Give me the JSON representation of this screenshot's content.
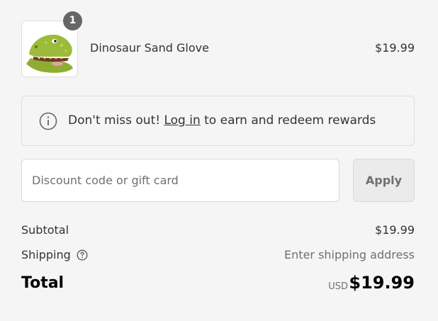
{
  "line_item": {
    "quantity": "1",
    "name": "Dinosaur Sand Glove",
    "price": "$19.99",
    "image": "dinosaur-sand-glove-thumbnail"
  },
  "rewards": {
    "text_before": "Don't miss out! ",
    "link_label": "Log in",
    "text_after": " to earn and redeem rewards",
    "icon": "info-icon"
  },
  "discount": {
    "placeholder": "Discount code or gift card",
    "value": "",
    "apply_label": "Apply"
  },
  "summary": {
    "subtotal_label": "Subtotal",
    "subtotal_value": "$19.99",
    "shipping_label": "Shipping",
    "shipping_help_icon": "question-circle-icon",
    "shipping_value": "Enter shipping address",
    "total_label": "Total",
    "currency": "USD",
    "total_value": "$19.99"
  },
  "colors": {
    "background": "#f5f5f5",
    "badge": "#666666",
    "muted_text": "#707070",
    "apply_button_bg": "#ebebeb",
    "product_green": "#9dbb3a"
  }
}
